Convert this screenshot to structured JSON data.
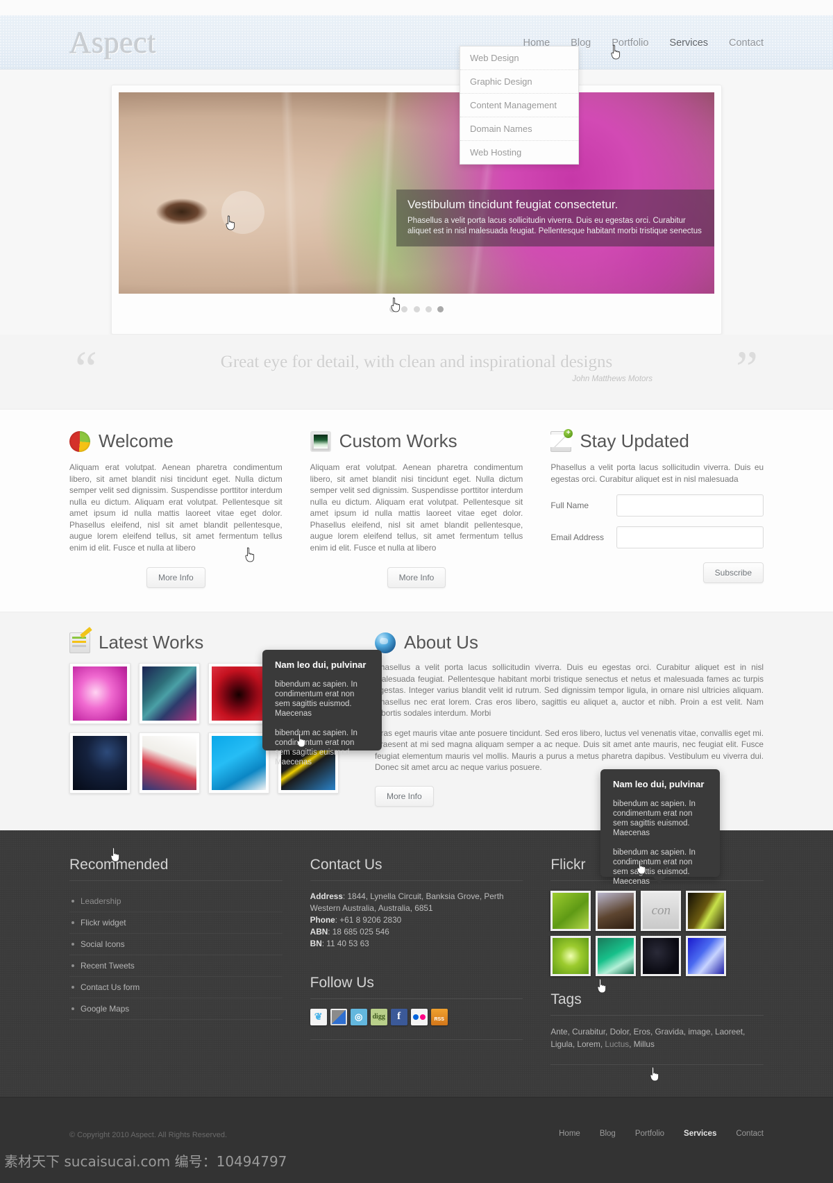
{
  "header": {
    "logo": "Aspect",
    "nav": [
      {
        "label": "Home",
        "active": false
      },
      {
        "label": "Blog",
        "active": false
      },
      {
        "label": "Portfolio",
        "active": false
      },
      {
        "label": "Services",
        "active": true
      },
      {
        "label": "Contact",
        "active": false
      }
    ],
    "dropdown": [
      {
        "label": "Web Design"
      },
      {
        "label": "Graphic Design"
      },
      {
        "label": "Content Management"
      },
      {
        "label": "Domain Names"
      },
      {
        "label": "Web Hosting"
      }
    ]
  },
  "slider": {
    "caption_title": "Vestibulum tincidunt feugiat consectetur.",
    "caption_text": "Phasellus a velit porta lacus sollicitudin viverra. Duis eu egestas orci. Curabitur aliquet est in nisl malesuada feugiat. Pellentesque habitant morbi tristique senectus",
    "dots": 5,
    "active_dot": 4
  },
  "quote": {
    "text": "Great eye for detail, with clean and inspirational designs",
    "author": "John Matthews Motors",
    "open_mark": "“",
    "close_mark": "”"
  },
  "columns": [
    {
      "icon": "pie-chart-icon",
      "title": "Welcome",
      "body": "Aliquam erat volutpat. Aenean pharetra condimentum libero, sit amet blandit nisi tincidunt eget. Nulla dictum semper velit sed dignissim. Suspendisse porttitor interdum nulla eu dictum. Aliquam erat volutpat. Pellentesque sit amet ipsum id nulla mattis laoreet vitae eget dolor. Phasellus eleifend, nisl sit amet blandit pellentesque, augue lorem eleifend tellus, sit amet fermentum tellus enim id elit. Fusce et nulla at libero",
      "button": "More Info"
    },
    {
      "icon": "monitor-icon",
      "title": "Custom Works",
      "body": "Aliquam erat volutpat. Aenean pharetra condimentum libero, sit amet blandit nisi tincidunt eget. Nulla dictum semper velit sed dignissim. Suspendisse porttitor interdum nulla eu dictum. Aliquam erat volutpat. Pellentesque sit amet ipsum id nulla mattis laoreet vitae eget dolor. Phasellus eleifend, nisl sit amet blandit pellentesque, augue lorem eleifend tellus, sit amet fermentum tellus enim id elit. Fusce et nulla at libero",
      "button": "More Info"
    }
  ],
  "newsletter": {
    "icon": "mail-add-icon",
    "title": "Stay Updated",
    "body": "Phasellus a velit porta lacus sollicitudin viverra. Duis eu egestas orci. Curabitur aliquet est in nisl malesuada",
    "full_name_label": "Full Name",
    "full_name_value": "",
    "email_label": "Email Address",
    "email_value": "",
    "button": "Subscribe"
  },
  "latest_works": {
    "icon": "note-pencil-icon",
    "title": "Latest Works",
    "thumbs": [
      "work-thumb-1",
      "work-thumb-2",
      "work-thumb-3",
      "work-thumb-4",
      "work-thumb-5",
      "work-thumb-6",
      "work-thumb-7",
      "work-thumb-8"
    ]
  },
  "tooltip": {
    "title": "Nam leo dui, pulvinar",
    "p1": "bibendum ac sapien. In condimentum erat non sem sagittis euismod. Maecenas",
    "p2": "bibendum ac sapien. In condimentum erat non sem sagittis euismod. Maecenas"
  },
  "about": {
    "icon": "globe-icon",
    "title": "About Us",
    "p1": "Phasellus a velit porta lacus sollicitudin viverra. Duis eu egestas orci. Curabitur aliquet est in nisl malesuada feugiat. Pellentesque habitant morbi tristique senectus et netus et malesuada fames ac turpis egestas. Integer varius blandit velit id rutrum. Sed dignissim tempor ligula, in ornare nisl ultricies aliquam. Phasellus nec erat lorem. Cras eros libero, sagittis eu aliquet a, auctor et nibh. Proin a est velit. Nam lobortis sodales interdum. Morbi",
    "p2": "Cras eget mauris vitae ante posuere tincidunt. Sed eros libero, luctus vel venenatis vitae, convallis eget mi. Praesent at mi sed magna aliquam semper a ac neque. Duis sit amet ante mauris, nec feugiat elit. Fusce feugiat elementum mauris vel mollis. Mauris a purus a metus pharetra dapibus. Vestibulum eu viverra dui. Donec sit amet arcu ac neque varius posuere.",
    "button": "More Info"
  },
  "footer": {
    "recommended": {
      "title": "Recommended",
      "items": [
        {
          "label": "Leadership",
          "hover": true
        },
        {
          "label": "Flickr widget",
          "hover": false
        },
        {
          "label": "Social Icons",
          "hover": false
        },
        {
          "label": "Recent Tweets",
          "hover": false
        },
        {
          "label": "Contact Us form",
          "hover": false
        },
        {
          "label": "Google Maps",
          "hover": false
        }
      ]
    },
    "contact": {
      "title": "Contact Us",
      "address_label": "Address",
      "address_value": "1844, Lynella Circuit, Banksia Grove, Perth Western Australia, Australia, 6851",
      "phone_label": "Phone",
      "phone_value": "+61 8 9206 2830",
      "abn_label": "ABN",
      "abn_value": "18 685 025 546",
      "bn_label": "BN",
      "bn_value": "11 40 53 63"
    },
    "follow": {
      "title": "Follow Us",
      "icons": [
        {
          "name": "twitter-icon",
          "glyph": "❦",
          "cls": "soc-tw"
        },
        {
          "name": "delicious-icon",
          "glyph": "",
          "cls": "soc-del"
        },
        {
          "name": "stumbleupon-icon",
          "glyph": "◎",
          "cls": "soc-sb"
        },
        {
          "name": "digg-icon",
          "glyph": "digg",
          "cls": "soc-digg"
        },
        {
          "name": "facebook-icon",
          "glyph": "f",
          "cls": "soc-fb"
        },
        {
          "name": "flickr-icon",
          "glyph": "",
          "cls": "soc-fl"
        },
        {
          "name": "rss-icon",
          "glyph": "RSS",
          "cls": "soc-rss"
        }
      ]
    },
    "flickr": {
      "title": "Flickr",
      "thumbs": [
        "flickr-thumb-1",
        "flickr-thumb-2",
        "flickr-thumb-3",
        "flickr-thumb-4",
        "flickr-thumb-5",
        "flickr-thumb-6",
        "flickr-thumb-7",
        "flickr-thumb-8"
      ]
    },
    "tags": {
      "title": "Tags",
      "line1": "Ante, Curabitur, Dolor, Eros, Gravida, image, Laoreet,",
      "line2_before": "Ligula, Lorem, ",
      "line2_hl": "Luctus",
      "line2_after": ", Millus"
    },
    "copyright": "© Copyright 2010 Aspect. All Rights Reserved.",
    "nav": [
      {
        "label": "Home",
        "active": false
      },
      {
        "label": "Blog",
        "active": false
      },
      {
        "label": "Portfolio",
        "active": false
      },
      {
        "label": "Services",
        "active": true
      },
      {
        "label": "Contact",
        "active": false
      }
    ],
    "watermark": "素材天下 sucaisucai.com 编号：10494797"
  }
}
